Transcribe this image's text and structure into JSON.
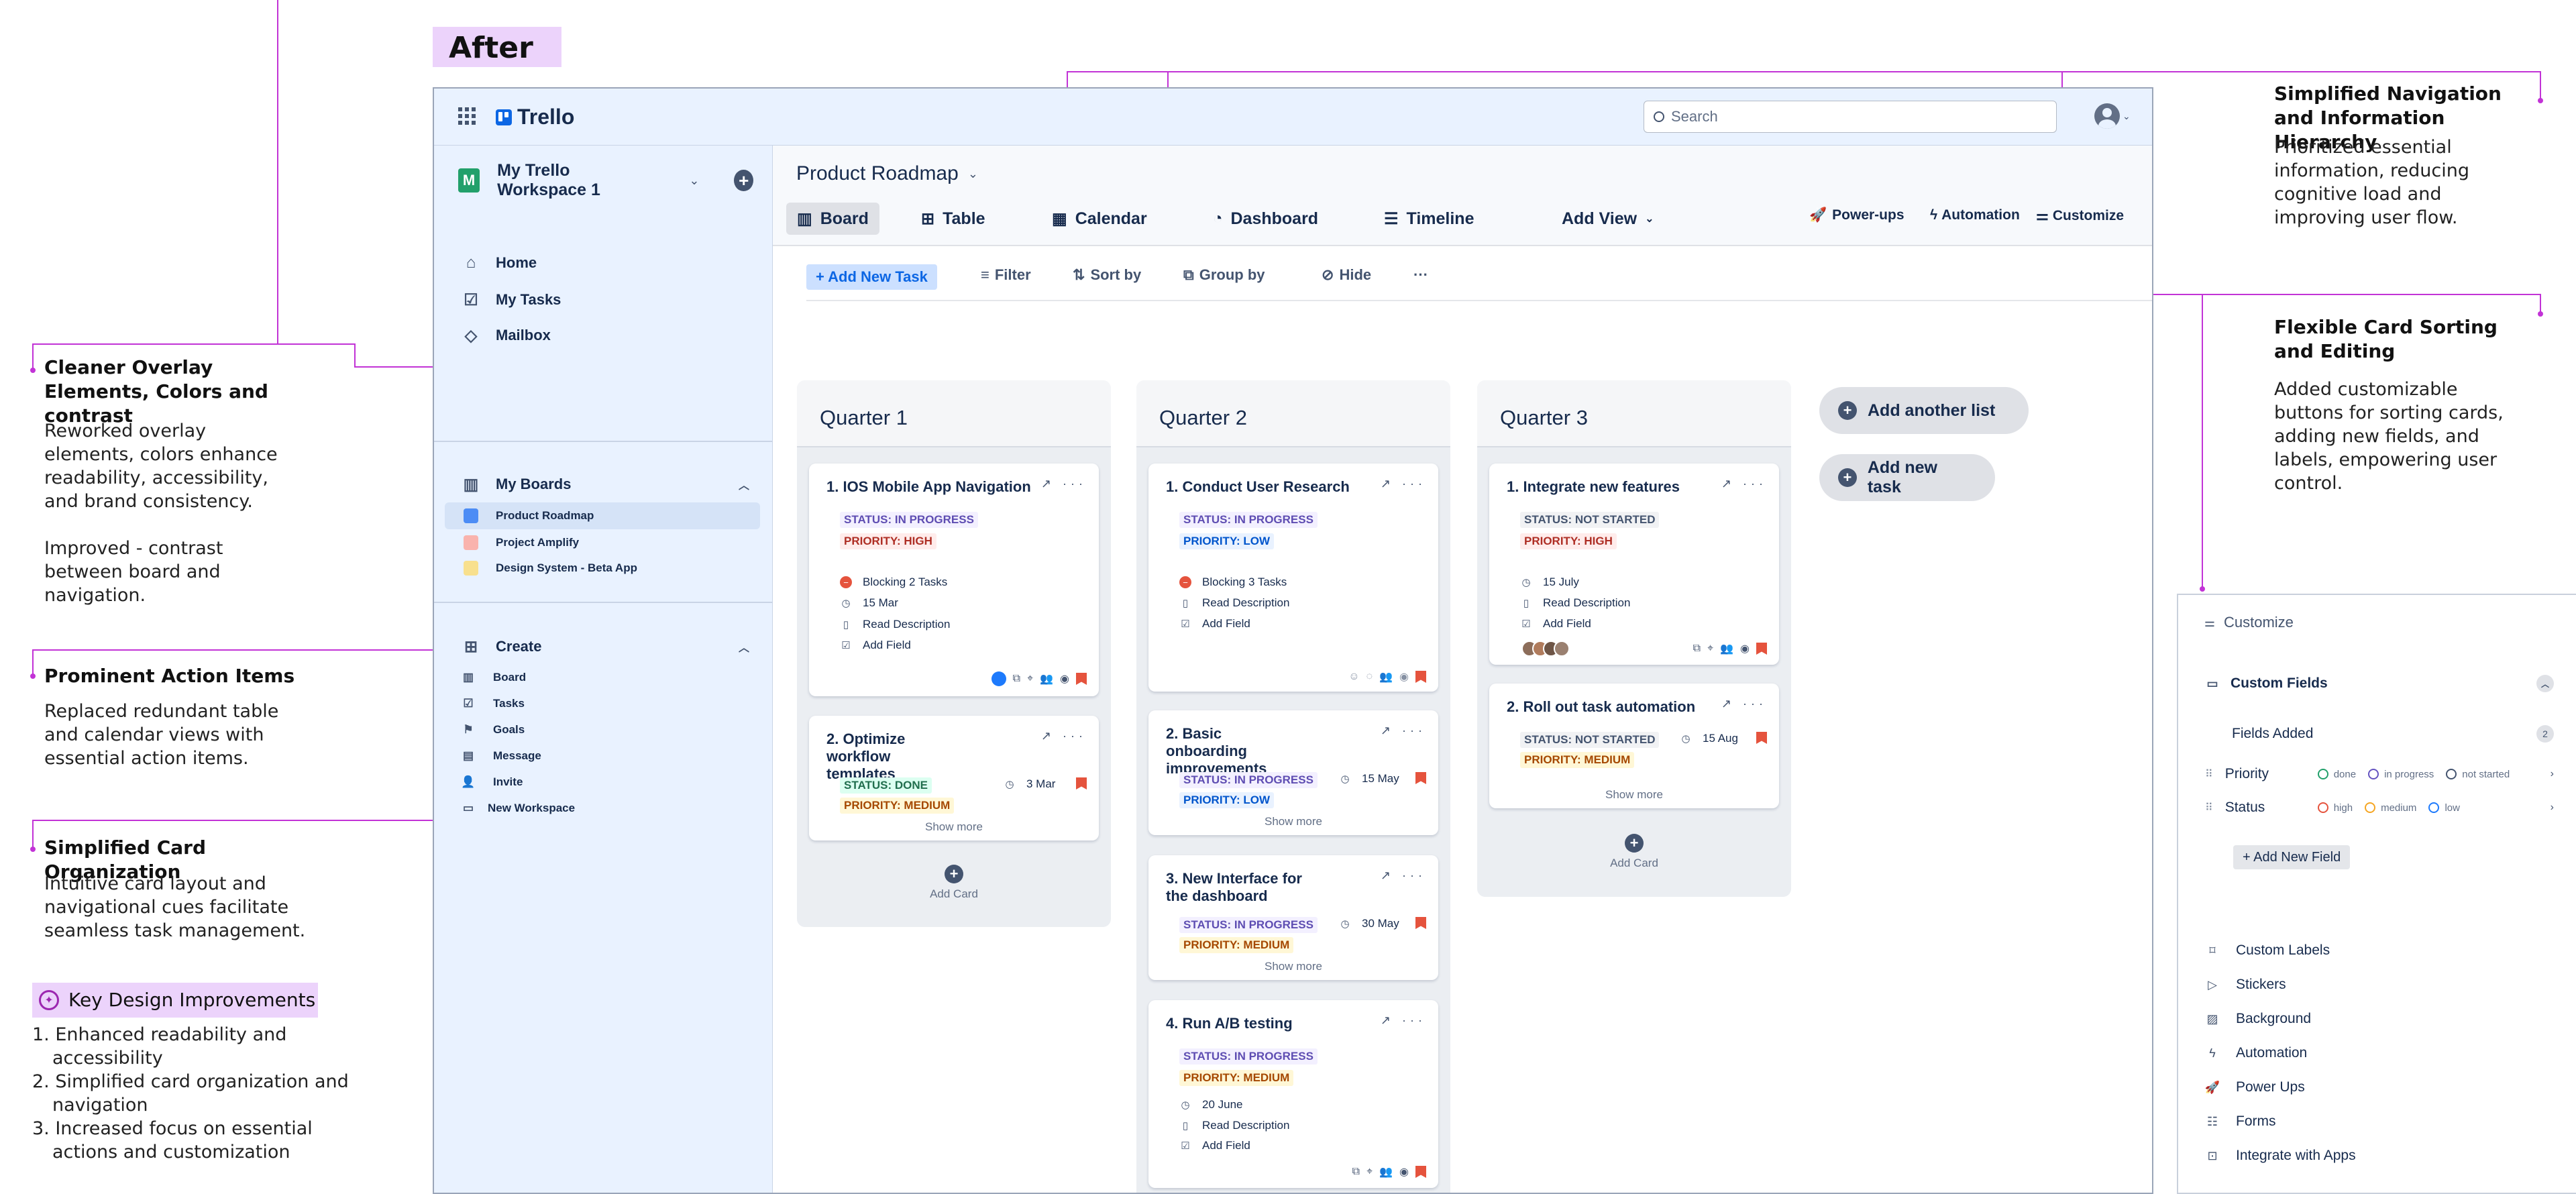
{
  "heading": {
    "after": "After"
  },
  "annotations": {
    "overlay_title": "Cleaner Overlay Elements, Colors and contrast",
    "overlay_body": "Reworked overlay elements, colors enhance readability, accessibility, and brand consistency.",
    "overlay_body2": "Improved - contrast between board and navigation.",
    "action_title": "Prominent Action Items",
    "action_body": "Replaced redundant table and calendar views with essential action items.",
    "card_title": "Simplified Card Organization",
    "card_body": "Intuitive card layout and navigational cues facilitate seamless task management.",
    "key_title": "Key Design Improvements",
    "key_items": [
      "1. Enhanced readability and accessibility",
      "2. Simplified card organization and navigation",
      "3. Increased focus on essential actions and customization"
    ],
    "nav_title": "Simplified Navigation and Information Hierarchy",
    "nav_body": "Prioritized essential information, reducing cognitive load and improving user flow.",
    "sort_title": "Flexible Card Sorting and Editing",
    "sort_body": "Added customizable buttons for sorting cards, adding new fields, and labels, empowering user control."
  },
  "topbar": {
    "logo": "Trello",
    "search_placeholder": "Search"
  },
  "sidebar": {
    "workspace": "My Trello Workspace 1",
    "workspace_initial": "M",
    "nav": [
      "Home",
      "My Tasks",
      "Mailbox"
    ],
    "boards_title": "My Boards",
    "boards": [
      {
        "name": "Product Roadmap",
        "color": "#4c8cf5"
      },
      {
        "name": "Project Amplify",
        "color": "#f9b3ad"
      },
      {
        "name": "Design System - Beta App",
        "color": "#f8e08e"
      }
    ],
    "create_title": "Create",
    "create_items": [
      "Board",
      "Tasks",
      "Goals",
      "Message",
      "Invite",
      "New Workspace"
    ]
  },
  "board": {
    "title": "Product Roadmap",
    "views": [
      "Board",
      "Table",
      "Calendar",
      "Dashboard",
      "Timeline",
      "Add View"
    ],
    "right_actions": [
      "Power-ups",
      "Automation",
      "Customize"
    ],
    "toolbar": [
      "+ Add New Task",
      "Filter",
      "Sort by",
      "Group by",
      "Hide",
      "···"
    ]
  },
  "lists": [
    {
      "title": "Quarter 1",
      "add_card": "Add Card",
      "cards": [
        {
          "title": "1. IOS Mobile App Navigation",
          "status": "STATUS: IN PROGRESS",
          "priority": "PRIORITY: HIGH",
          "blocking": "Blocking 2 Tasks",
          "date": "15 Mar",
          "desc": "Read Description",
          "field": "Add Field"
        },
        {
          "title": "2. Optimize workflow templates",
          "status": "STATUS: DONE",
          "priority": "PRIORITY: MEDIUM",
          "date": "3 Mar",
          "show_more": "Show more"
        }
      ]
    },
    {
      "title": "Quarter 2",
      "cards": [
        {
          "title": "1. Conduct User Research",
          "status": "STATUS: IN PROGRESS",
          "priority": "PRIORITY: LOW",
          "blocking": "Blocking 3 Tasks",
          "desc": "Read Description",
          "field": "Add Field"
        },
        {
          "title": "2. Basic onboarding improvements",
          "status": "STATUS: IN PROGRESS",
          "priority": "PRIORITY: LOW",
          "date": "15 May",
          "show_more": "Show more"
        },
        {
          "title": "3. New Interface for the dashboard",
          "status": "STATUS: IN PROGRESS",
          "priority": "PRIORITY: MEDIUM",
          "date": "30 May",
          "show_more": "Show more"
        },
        {
          "title": "4. Run A/B testing",
          "status": "STATUS: IN PROGRESS",
          "priority": "PRIORITY: MEDIUM",
          "date": "20 June",
          "desc": "Read Description",
          "field": "Add Field"
        }
      ]
    },
    {
      "title": "Quarter 3",
      "add_card": "Add Card",
      "cards": [
        {
          "title": "1. Integrate new features",
          "status": "STATUS: NOT STARTED",
          "priority": "PRIORITY: HIGH",
          "date": "15 July",
          "desc": "Read Description",
          "field": "Add Field"
        },
        {
          "title": "2. Roll out task automation",
          "status": "STATUS: NOT STARTED",
          "priority": "PRIORITY: MEDIUM",
          "date": "15 Aug",
          "show_more": "Show more"
        }
      ]
    }
  ],
  "extra_buttons": [
    "Add another list",
    "Add new task"
  ],
  "customize_panel": {
    "title": "Customize",
    "custom_fields": "Custom Fields",
    "fields_added": "Fields Added",
    "fields_count": "2",
    "priority": "Priority",
    "priority_opts": [
      "done",
      "in progress",
      "not started"
    ],
    "status": "Status",
    "status_opts": [
      "high",
      "medium",
      "low"
    ],
    "add_new_field": "+ Add New Field",
    "items": [
      "Custom Labels",
      "Stickers",
      "Background",
      "Automation",
      "Power Ups",
      "Forms",
      "Integrate with Apps"
    ]
  },
  "colors": {
    "accent": "#c233d6",
    "nav_bg": "#e9f2ff",
    "list_bg": "#ebeef2"
  }
}
